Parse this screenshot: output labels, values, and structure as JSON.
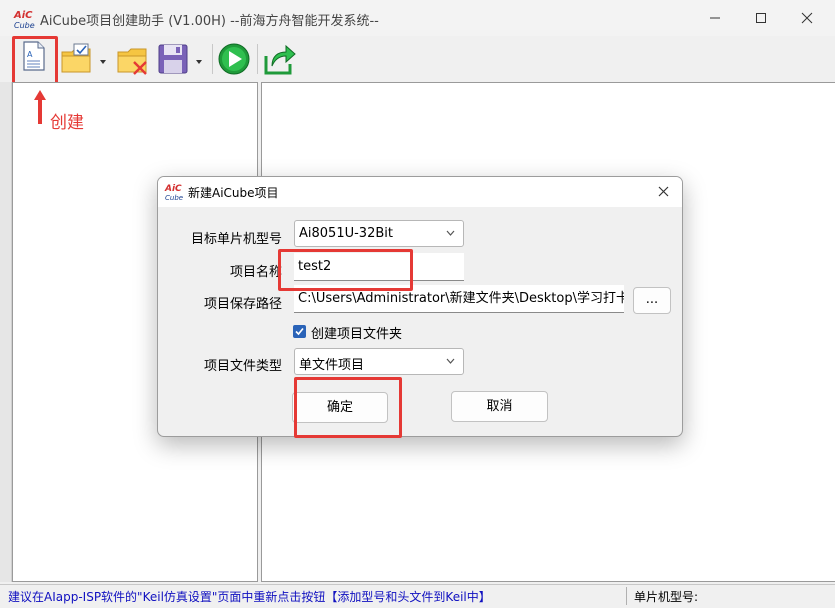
{
  "window": {
    "title": "AiCube项目创建助手 (V1.00H) --前海方舟智能开发系统--"
  },
  "logo": {
    "line1": "AiC",
    "line2": "Cube"
  },
  "toolbar": {
    "items": [
      "new-project",
      "open-project",
      "close-project",
      "save-project",
      "run",
      "export"
    ]
  },
  "annotation": {
    "label": "创建"
  },
  "statusbar": {
    "hint": "建议在AIapp-ISP软件的\"Keil仿真设置\"页面中重新点击按钮【添加型号和头文件到Keil中】",
    "mcu_label": "单片机型号:"
  },
  "dialog": {
    "title": "新建AiCube项目",
    "mcu_label": "目标单片机型号",
    "mcu_value": "Ai8051U-32Bit",
    "name_label": "项目名称",
    "name_value": "test2",
    "path_label": "项目保存路径",
    "path_value": "C:\\Users\\Administrator\\新建文件夹\\Desktop\\学习打卡",
    "browse_label": "...",
    "create_folder_label": "创建项目文件夹",
    "create_folder_checked": true,
    "type_label": "项目文件类型",
    "type_value": "单文件项目",
    "ok_label": "确定",
    "cancel_label": "取消"
  },
  "colors": {
    "highlight": "#e53935",
    "accent": "#2a63b8",
    "status_text": "#1010c0"
  }
}
